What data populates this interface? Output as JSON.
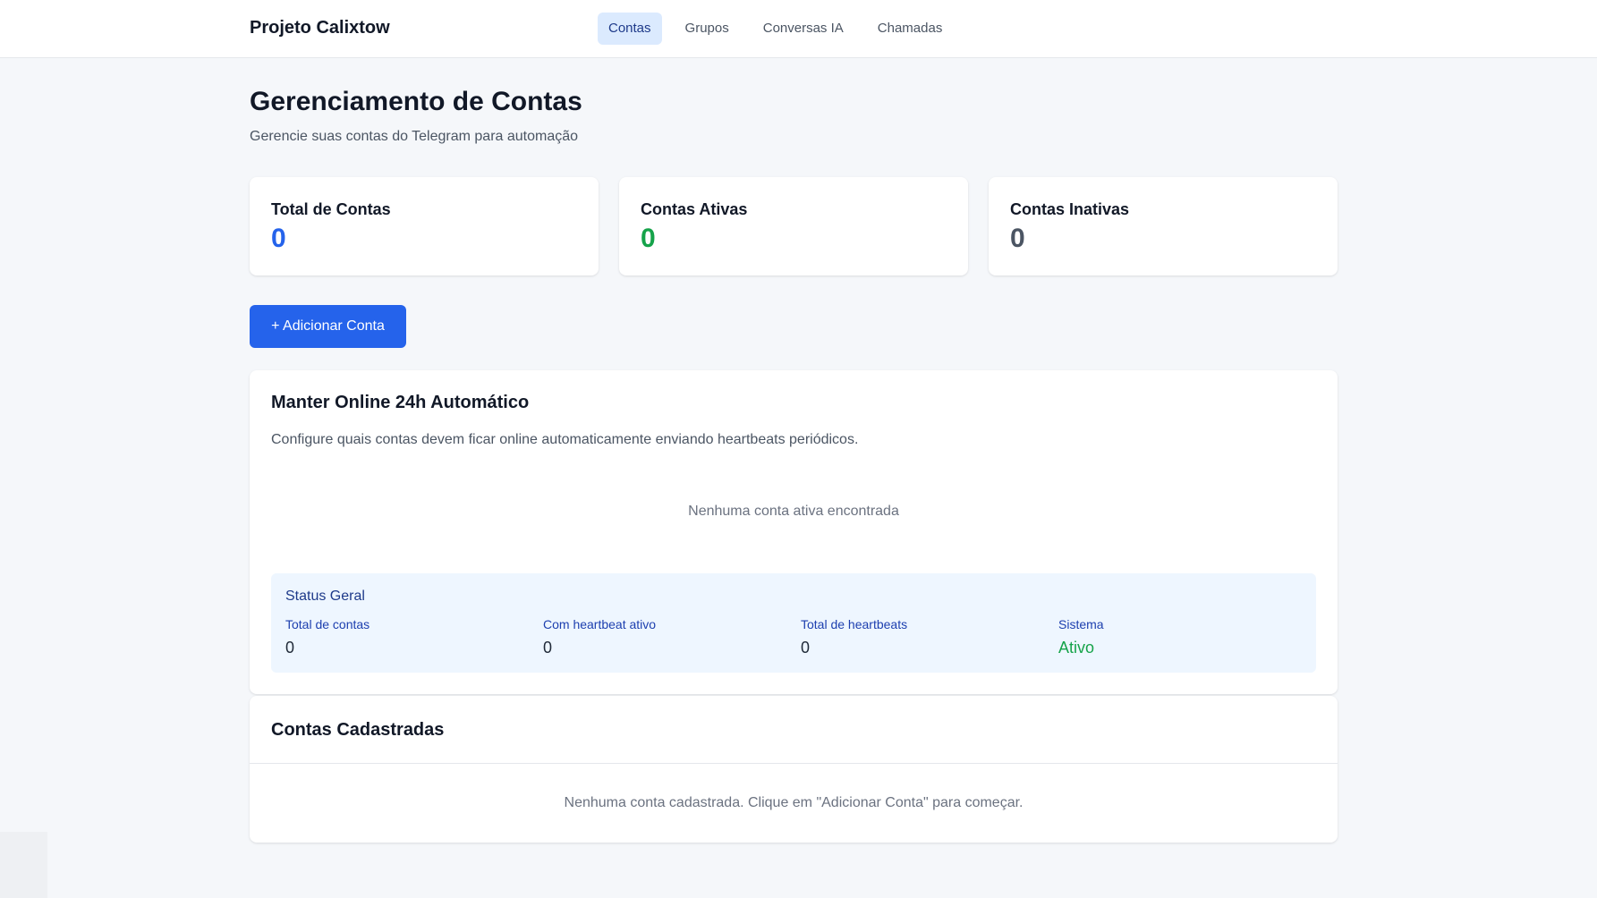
{
  "app": {
    "brand": "Projeto Calixtow"
  },
  "nav": {
    "items": [
      {
        "label": "Contas",
        "active": true
      },
      {
        "label": "Grupos",
        "active": false
      },
      {
        "label": "Conversas IA",
        "active": false
      },
      {
        "label": "Chamadas",
        "active": false
      }
    ]
  },
  "header": {
    "title": "Gerenciamento de Contas",
    "subtitle": "Gerencie suas contas do Telegram para automação"
  },
  "stats": [
    {
      "label": "Total de Contas",
      "value": "0",
      "color": "#2563eb"
    },
    {
      "label": "Contas Ativas",
      "value": "0",
      "color": "#16a34a"
    },
    {
      "label": "Contas Inativas",
      "value": "0",
      "color": "#4b5563"
    }
  ],
  "actions": {
    "add_account_label": "+ Adicionar Conta"
  },
  "heartbeat": {
    "title": "Manter Online 24h Automático",
    "description": "Configure quais contas devem ficar online automaticamente enviando heartbeats periódicos.",
    "empty_text": "Nenhuma conta ativa encontrada",
    "status": {
      "title": "Status Geral",
      "items": [
        {
          "label": "Total de contas",
          "value": "0"
        },
        {
          "label": "Com heartbeat ativo",
          "value": "0"
        },
        {
          "label": "Total de heartbeats",
          "value": "0"
        },
        {
          "label": "Sistema",
          "value": "Ativo",
          "color": "#16a34a"
        }
      ]
    }
  },
  "accounts": {
    "title": "Contas Cadastradas",
    "empty_text": "Nenhuma conta cadastrada. Clique em \"Adicionar Conta\" para começar."
  },
  "colors": {
    "primary": "#2563eb",
    "success": "#16a34a",
    "muted": "#4b5563",
    "nav_active_bg": "#dbeafe"
  }
}
